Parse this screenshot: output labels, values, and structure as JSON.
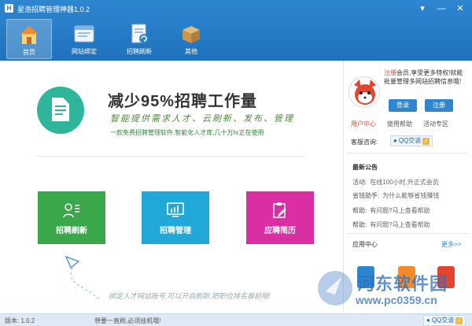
{
  "window": {
    "title": "星浩招聘管理神器1.0.2",
    "controls": [
      "▾",
      "—",
      "✕"
    ]
  },
  "toolbar": [
    {
      "label": "首页",
      "icon": "house-icon",
      "active": true
    },
    {
      "label": "网站绑定",
      "icon": "browser-window-icon",
      "active": false
    },
    {
      "label": "招聘刷新",
      "icon": "document-refresh-icon",
      "active": false
    },
    {
      "label": "其他",
      "icon": "package-box-icon",
      "active": false
    }
  ],
  "hero": {
    "title": "减少95%招聘工作量",
    "subtitle": "智能提供需求人才、云刷新、发布、管理",
    "description": "一款免费招聘管理软件,智能化人才库,几十万hr正在使用"
  },
  "tiles": [
    {
      "label": "招聘刷新",
      "color": "#3aa84a",
      "icon": "person-list-icon"
    },
    {
      "label": "招聘管理",
      "color": "#1fa8d8",
      "icon": "monitor-chart-icon"
    },
    {
      "label": "应聘简历",
      "color": "#d92fa3",
      "icon": "clipboard-edit-icon"
    }
  ],
  "plane_note": "绑定人才网站账号,可以开启刷新,把职位排名靠前哦!",
  "right": {
    "promo_link": "注册",
    "promo_text": "会员,享受更多特权!就能批量管理多网站招聘信息哦!",
    "login": "登录",
    "register": "注册",
    "links": [
      "用户中心",
      "使用帮助",
      "活动专区"
    ],
    "service_label": "客服咨询:",
    "qq_label": "QQ交谈",
    "announcement_title": "最新公告",
    "announcements": [
      {
        "key": "活动:",
        "text": "在线100小时,升正式会员"
      },
      {
        "key": "省钱助手:",
        "text": "为什么能够省钱赚钱"
      },
      {
        "key": "帮助:",
        "text": "有问题?马上查看帮助"
      },
      {
        "key": "帮助:",
        "text": "有问题?马上查看帮助"
      }
    ],
    "apps_title": "应用中心",
    "apps_more": "更多>>"
  },
  "status": {
    "version": "版本: 1.0.2",
    "message": "想要一直刷,必须挂机哦!",
    "qq_label": "QQ交谈"
  },
  "watermark": {
    "text": "河东软件园",
    "url": "www.pc0359.cn"
  }
}
